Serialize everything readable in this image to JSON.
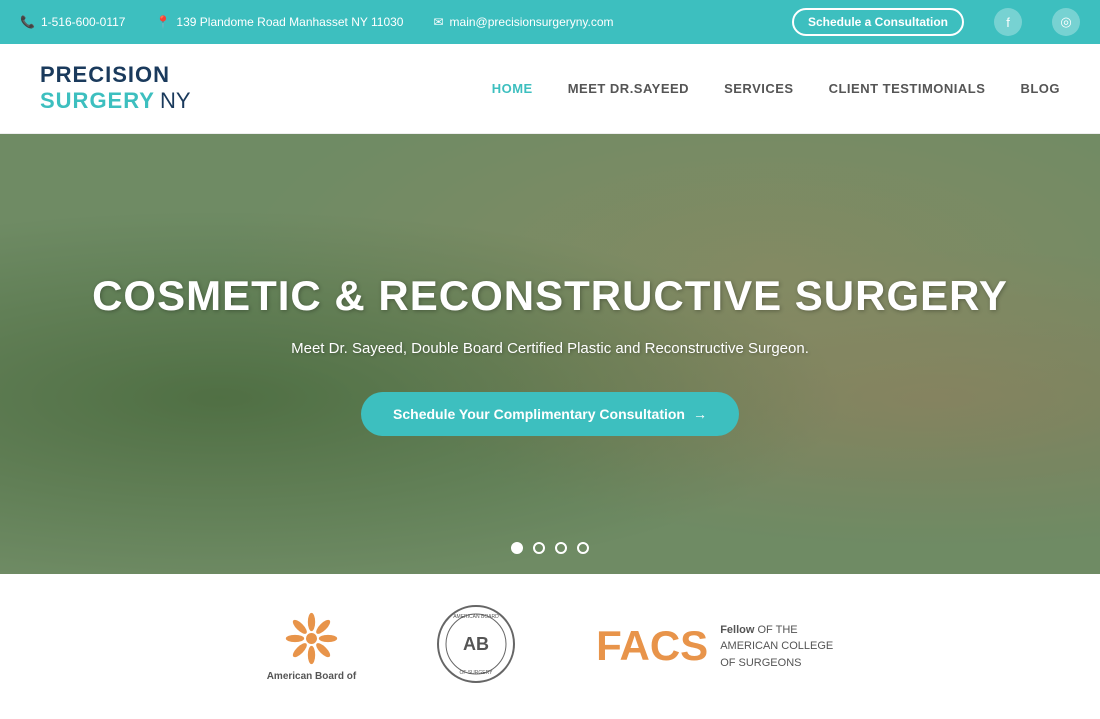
{
  "topbar": {
    "phone": "1-516-600-0117",
    "address": "139 Plandome Road Manhasset NY 11030",
    "email": "main@precisionsurgeryny.com",
    "schedule_btn": "Schedule a Consultation",
    "phone_icon": "📞",
    "location_icon": "📍",
    "email_icon": "✉"
  },
  "navbar": {
    "logo_line1": "PRECISION",
    "logo_line2": "SURGERY",
    "logo_line3": "NY",
    "links": [
      {
        "label": "HOME",
        "active": true
      },
      {
        "label": "MEET DR.SAYEED",
        "active": false
      },
      {
        "label": "SERVICES",
        "active": false
      },
      {
        "label": "CLIENT TESTIMONIALS",
        "active": false
      },
      {
        "label": "BLOG",
        "active": false
      }
    ]
  },
  "hero": {
    "title": "COSMETIC & RECONSTRUCTIVE SURGERY",
    "subtitle": "Meet Dr. Sayeed, Double Board Certified Plastic and Reconstructive Surgeon.",
    "cta_label": "Schedule Your Complimentary Consultation",
    "dots": [
      {
        "active": true
      },
      {
        "active": false
      },
      {
        "active": false
      },
      {
        "active": false
      }
    ]
  },
  "logos": {
    "ab_star": "✳",
    "ab_label": "American Board of",
    "facs_text": "FACS",
    "facs_subtitle_bold": "Fellow",
    "facs_subtitle": " OF THE\nAMERICAN COLLEGE\nOF SURGEONS"
  }
}
